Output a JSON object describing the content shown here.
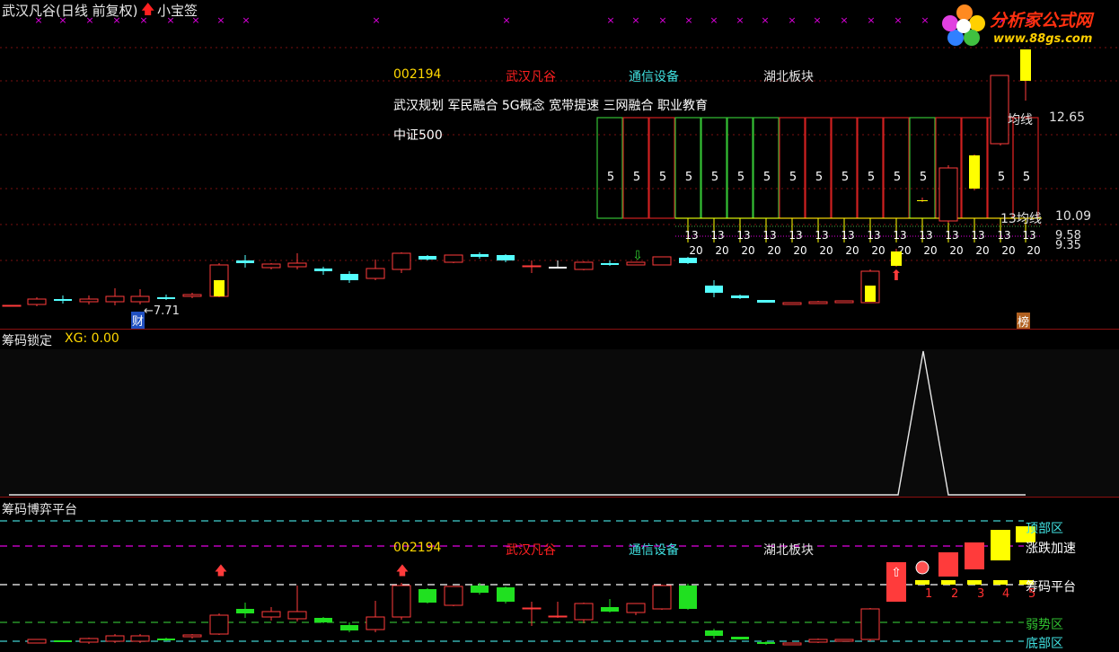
{
  "main": {
    "title": "武汉凡谷(日线 前复权)",
    "tag": "小宝签",
    "info": {
      "code": "002194",
      "name": "武汉凡谷",
      "industry": "通信设备",
      "region": "湖北板块",
      "concepts": "武汉规划 军民融合 5G概念 宽带提速 三网融合 职业教育",
      "index": "中证500"
    },
    "ma_labels": [
      {
        "text": "均线",
        "value": "12.65"
      },
      {
        "text": "13均线",
        "value": "10.09"
      },
      {
        "text": "",
        "value": "9.58"
      },
      {
        "text": "",
        "value": "9.35"
      }
    ],
    "low_marker": "7.71",
    "cai_badge": "财",
    "bang_badge": "榜",
    "box_number": "5",
    "small_13": "13",
    "small_20": "20"
  },
  "panel2": {
    "title": "筹码锁定",
    "indicator": "XG: 0.00"
  },
  "panel3": {
    "title": "筹码博弈平台",
    "info": {
      "code": "002194",
      "name": "武汉凡谷",
      "industry": "通信设备",
      "region": "湖北板块"
    },
    "zones": [
      "顶部区",
      "涨跌加速",
      "筹码平台",
      "弱势区",
      "底部区"
    ],
    "counters": [
      "1",
      "2",
      "3",
      "4",
      "5"
    ]
  },
  "logo": {
    "name": "分析家公式网",
    "url": "www.88gs.com"
  },
  "colors": {
    "up": "#ff3b3b",
    "down": "#54ffff",
    "yellow": "#ffff00",
    "green_box": "#34c034",
    "red_box": "#d02020",
    "magenta": "#e000e0",
    "white": "#ffffff"
  }
}
